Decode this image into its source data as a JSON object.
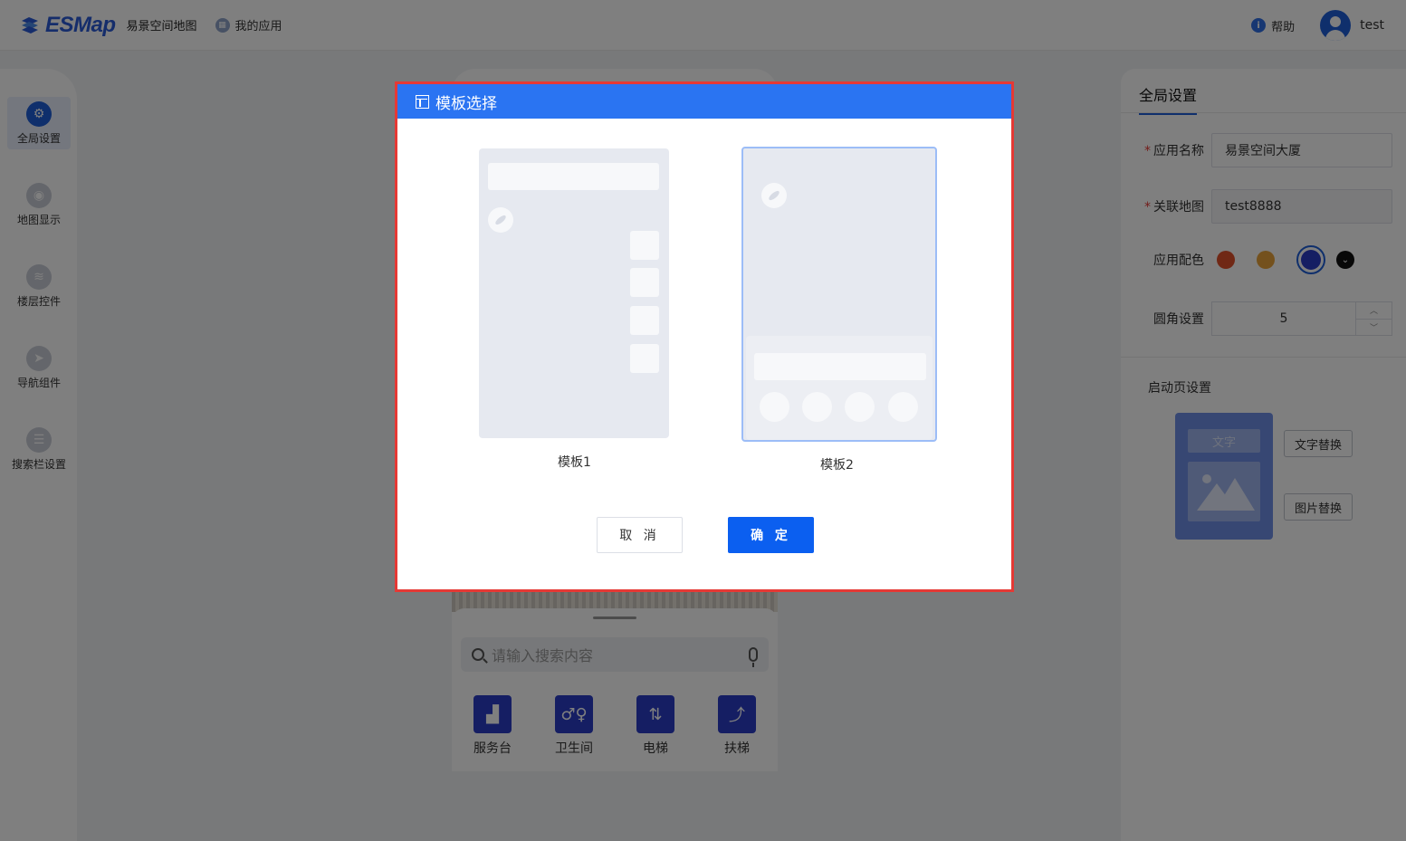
{
  "header": {
    "brand": "ESMap",
    "app_name": "易景空间地图",
    "my_apps": "我的应用",
    "help": "帮助",
    "username": "test"
  },
  "sidebar": {
    "items": [
      {
        "label": "全局设置",
        "icon": "gear-icon",
        "active": true
      },
      {
        "label": "地图显示",
        "icon": "map-pin-icon",
        "active": false
      },
      {
        "label": "楼层控件",
        "icon": "layers-icon",
        "active": false
      },
      {
        "label": "导航组件",
        "icon": "navigation-icon",
        "active": false
      },
      {
        "label": "搜索栏设置",
        "icon": "menu-icon",
        "active": false
      }
    ]
  },
  "preview": {
    "search_placeholder": "请输入搜索内容",
    "facilities": [
      {
        "label": "服务台",
        "icon": "service-desk-icon"
      },
      {
        "label": "卫生间",
        "icon": "restroom-icon"
      },
      {
        "label": "电梯",
        "icon": "elevator-icon"
      },
      {
        "label": "扶梯",
        "icon": "escalator-icon"
      }
    ]
  },
  "settings": {
    "tab": "全局设置",
    "app_name_label": "应用名称",
    "app_name_value": "易景空间大厦",
    "map_label": "关联地图",
    "map_value": "test8888",
    "color_label": "应用配色",
    "colors": [
      "#e0502a",
      "#e8a33a",
      "#2b3cc6",
      "#111111"
    ],
    "selected_color": "#2b3cc6",
    "radius_label": "圆角设置",
    "radius_value": "5",
    "launch_title": "启动页设置",
    "launch_word": "文字",
    "replace_text": "文字替换",
    "replace_image": "图片替换"
  },
  "modal": {
    "title": "模板选择",
    "templates": [
      {
        "name": "模板1",
        "selected": false
      },
      {
        "name": "模板2",
        "selected": true
      }
    ],
    "cancel": "取 消",
    "confirm": "确 定"
  },
  "accent_color": "#1f5fd8",
  "dialog_header_color": "#2a74f2"
}
